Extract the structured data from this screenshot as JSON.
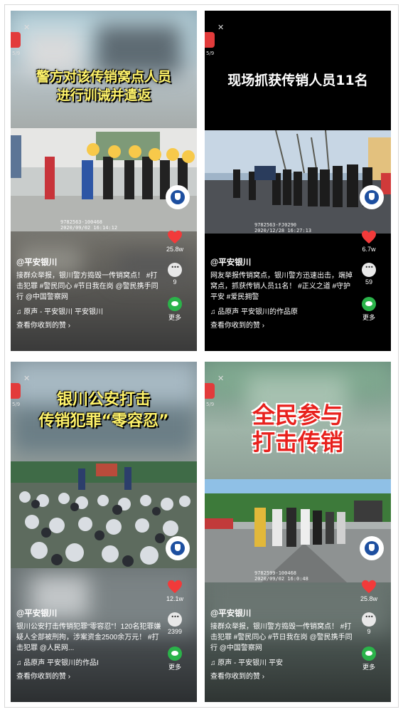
{
  "panels": [
    {
      "caption_lines": [
        "警方对该传销窝点人员",
        "进行训诫并遣返"
      ],
      "page_index": "5/9",
      "stamp": [
        "9782563-100468",
        "2020/09/02   16:14:12"
      ],
      "handle": "@平安银川",
      "description": "接群众举报，银川警方捣毁一传销窝点！ #打击犯罪 #警民同心 #节日我在岗 @警民携手同行 @中国警察网",
      "music": "原声 - 平安银川   平安银川",
      "like_count": "25.8w",
      "comment_count": "9",
      "share_label": "更多",
      "likes_received": "查看你收到的赞"
    },
    {
      "caption_lines": [
        "现场抓获传销人员11名"
      ],
      "page_index": "5/9",
      "stamp": [
        "9782563-FJ0290",
        "2020/12/28   16:27:13"
      ],
      "handle": "@平安银川",
      "description": "网友举报传销窝点，银川警方迅速出击，端掉窝点，抓获传销人员11名！ #正义之道 #守护平安 #爱民拥警",
      "music": "品原声   平安银川的作品原",
      "like_count": "6.7w",
      "comment_count": "59",
      "share_label": "更多",
      "likes_received": "查看你收到的赞"
    },
    {
      "caption_lines": [
        "银川公安打击",
        "传销犯罪“零容忍”"
      ],
      "page_index": "5/9",
      "stamp": [],
      "handle": "@平安银川",
      "description": "银川公安打击传销犯罪“零容忍”！120名犯罪嫌疑人全部被刑拘，涉案资金2500余万元！ #打击犯罪 @人民网...",
      "music": "品原声   平安银川的作品I",
      "like_count": "12.1w",
      "comment_count": "2399",
      "share_label": "更多",
      "likes_received": "查看你收到的赞"
    },
    {
      "caption_lines": [
        "全民参与",
        "打击传销"
      ],
      "page_index": "5/9",
      "stamp": [
        "9782599-100468",
        "2020/09/02   16:0:48"
      ],
      "handle": "@平安银川",
      "description": "接群众举报，银川警方捣毁一传销窝点！ #打击犯罪 #警民同心 #节日我在岗 @警民携手同行 @中国警察网",
      "music": "原声 - 平安银川   平安",
      "like_count": "25.8w",
      "comment_count": "9",
      "share_label": "更多",
      "likes_received": "查看你收到的赞"
    }
  ],
  "colors": {
    "caption_yellow": "#fff36a",
    "caption_red": "#e8211d",
    "heart_red": "#f23a3a",
    "wechat_green": "#2bb34a"
  },
  "icons": [
    "close-icon",
    "heart-icon",
    "comment-icon",
    "wechat-icon",
    "music-note-icon",
    "police-badge-icon",
    "chevron-right-icon"
  ]
}
